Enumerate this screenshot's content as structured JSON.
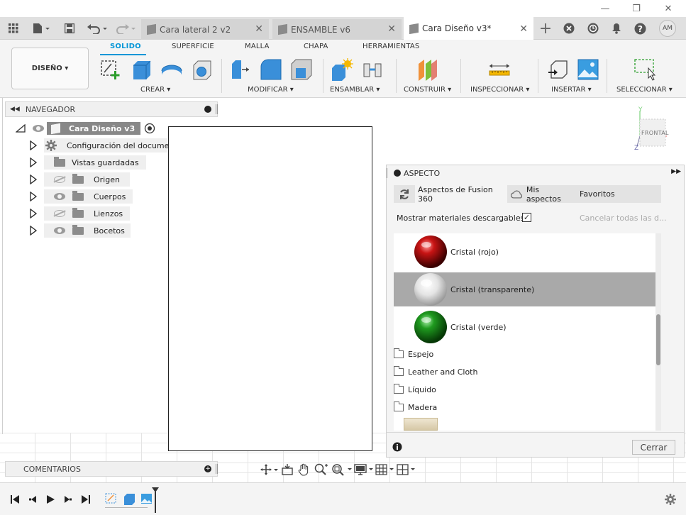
{
  "window": {
    "minimize": "—",
    "restore": "❐",
    "close": "✕"
  },
  "tabs": [
    {
      "label": "Cara lateral 2 v2",
      "active": false
    },
    {
      "label": "ENSAMBLE v6",
      "active": false
    },
    {
      "label": "Cara Diseño v3*",
      "active": true
    }
  ],
  "user": {
    "initials": "AM"
  },
  "ribbon": {
    "workspace": "DISEÑO ▾",
    "tabs": [
      "SOLIDO",
      "SUPERFICIE",
      "MALLA",
      "CHAPA",
      "HERRAMIENTAS"
    ],
    "active_tab": "SOLIDO",
    "groups": [
      "CREAR ▾",
      "MODIFICAR ▾",
      "ENSAMBLAR ▾",
      "CONSTRUIR ▾",
      "INSPECCIONAR ▾",
      "INSERTAR ▾",
      "SELECCIONAR ▾"
    ]
  },
  "navigator": {
    "title": "NAVEGADOR",
    "root": "Cara Diseño v3",
    "items": [
      {
        "label": "Configuración del documento",
        "icon": "gear-icon"
      },
      {
        "label": "Vistas guardadas",
        "icon": "folder-icon"
      },
      {
        "label": "Origen",
        "icon": "folder-icon",
        "visible": false
      },
      {
        "label": "Cuerpos",
        "icon": "folder-icon",
        "visible": true
      },
      {
        "label": "Lienzos",
        "icon": "folder-icon",
        "visible": false
      },
      {
        "label": "Bocetos",
        "icon": "folder-icon",
        "visible": true
      }
    ]
  },
  "viewcube": {
    "face": "FRONTAL",
    "axis_y": "Y",
    "axis_z": "Z"
  },
  "aspect_panel": {
    "title": "ASPECTO",
    "tabs": [
      "Aspectos de Fusion 360",
      "Mis aspectos",
      "Favoritos"
    ],
    "show_downloadable": "Mostrar materiales descargables",
    "cancel_all": "Cancelar todas las d...",
    "materials": [
      {
        "label": "Cristal (rojo)",
        "color": "#b01010",
        "selected": false
      },
      {
        "label": "Cristal (transparente)",
        "color": "#d8d8d8",
        "selected": true
      },
      {
        "label": "Cristal (verde)",
        "color": "#178a17",
        "selected": false
      }
    ],
    "folders": [
      "Espejo",
      "Leather and Cloth",
      "Líquido",
      "Madera"
    ],
    "close_label": "Cerrar"
  },
  "comments": {
    "title": "COMENTARIOS"
  },
  "colors": {
    "accent": "#0696d7"
  }
}
